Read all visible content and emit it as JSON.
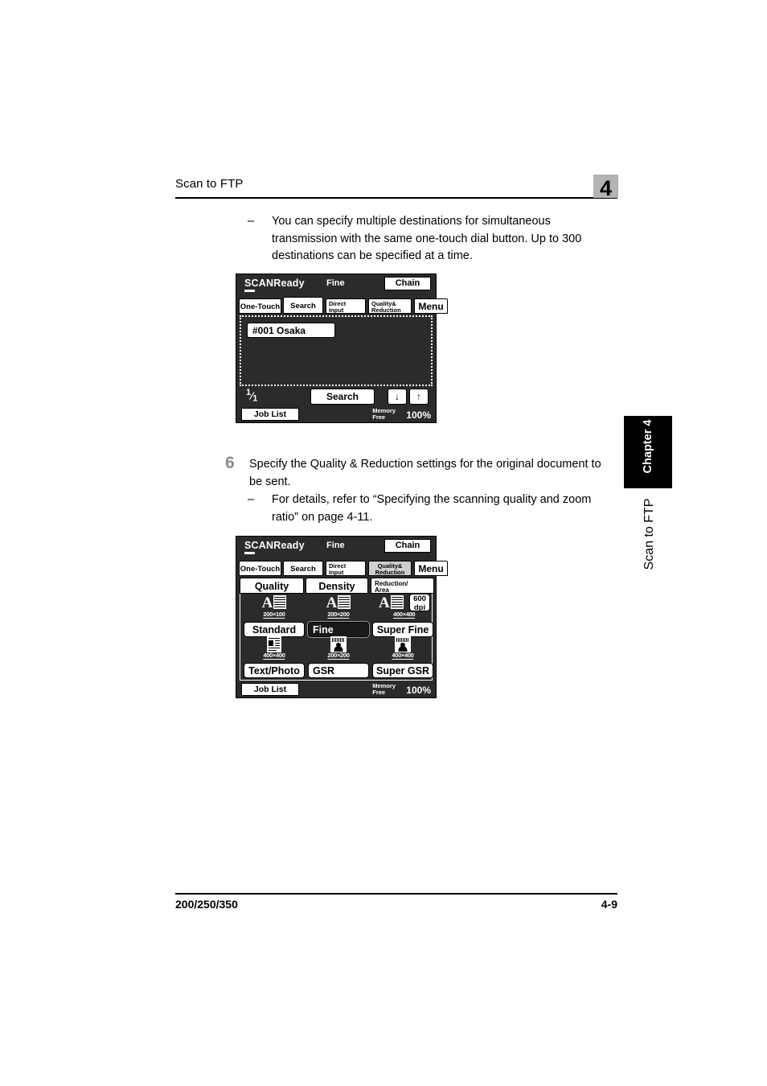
{
  "header": {
    "section_title": "Scan to FTP",
    "chapter_number": "4"
  },
  "body": {
    "note1": "You can specify multiple destinations for simultaneous transmission with the same one-touch dial button. Up to 300 destinations can be specified at a time.",
    "dash": "–",
    "step6": {
      "number": "6",
      "text": "Specify the Quality & Reduction settings for the original document to be sent.",
      "note": "For details, refer to “Specifying the scanning quality and zoom ratio” on page 4-11."
    }
  },
  "panel1": {
    "status": "SCANReady",
    "mode": "Fine",
    "chain_label": "Chain",
    "tabs": [
      {
        "line1": "One-Touch",
        "line2": "",
        "state": "normal"
      },
      {
        "line1": "Search",
        "line2": "",
        "state": "active"
      },
      {
        "line1": "Direct",
        "line2": "Input",
        "state": "normal"
      },
      {
        "line1": "Quality&",
        "line2": "Reduction",
        "state": "normal"
      },
      {
        "line1": "Menu",
        "line2": "",
        "state": "normal"
      }
    ],
    "destination": "#001 Osaka",
    "page_current": "1",
    "page_total": "1",
    "search_label": "Search",
    "arrow_down": "↓",
    "arrow_up": "↑",
    "job_list_label": "Job List",
    "memory_line1": "Memory",
    "memory_line2": "Free",
    "memory_percent": "100%"
  },
  "panel2": {
    "status": "SCANReady",
    "mode": "Fine",
    "chain_label": "Chain",
    "tabs": [
      {
        "line1": "One-Touch",
        "line2": "",
        "state": "normal"
      },
      {
        "line1": "Search",
        "line2": "",
        "state": "normal"
      },
      {
        "line1": "Direct",
        "line2": "Input",
        "state": "normal"
      },
      {
        "line1": "Quality&",
        "line2": "Reduction",
        "state": "dim"
      },
      {
        "line1": "Menu",
        "line2": "",
        "state": "normal"
      }
    ],
    "subtabs": [
      {
        "line1": "Quality",
        "line2": "",
        "state": "active"
      },
      {
        "line1": "Density",
        "line2": "",
        "state": "normal"
      },
      {
        "line1": "Reduction/",
        "line2": "Area",
        "state": "normal"
      }
    ],
    "quality_options": [
      {
        "label": "Standard",
        "resolution": "200×100",
        "icon": "text-doc-icon",
        "selected": false
      },
      {
        "label": "Fine",
        "resolution": "200×200",
        "icon": "text-doc-icon",
        "selected": true
      },
      {
        "label": "Super Fine",
        "resolution": "400×400",
        "icon": "text-doc-icon",
        "selected": false
      },
      {
        "label": "Text/Photo",
        "resolution": "400×400",
        "icon": "text-photo-icon",
        "selected": false
      },
      {
        "label": "GSR",
        "resolution": "200×200",
        "icon": "photo-icon",
        "selected": false
      },
      {
        "label": "Super GSR",
        "resolution": "400×400",
        "icon": "photo-icon",
        "selected": false
      }
    ],
    "dpi_button_line1": "600",
    "dpi_button_line2": "dpi",
    "job_list_label": "Job List",
    "memory_line1": "Memory",
    "memory_line2": "Free",
    "memory_percent": "100%"
  },
  "sidebar": {
    "chapter_tab": "Chapter 4",
    "section_label": "Scan to FTP"
  },
  "footer": {
    "model": "200/250/350",
    "page": "4-9"
  }
}
